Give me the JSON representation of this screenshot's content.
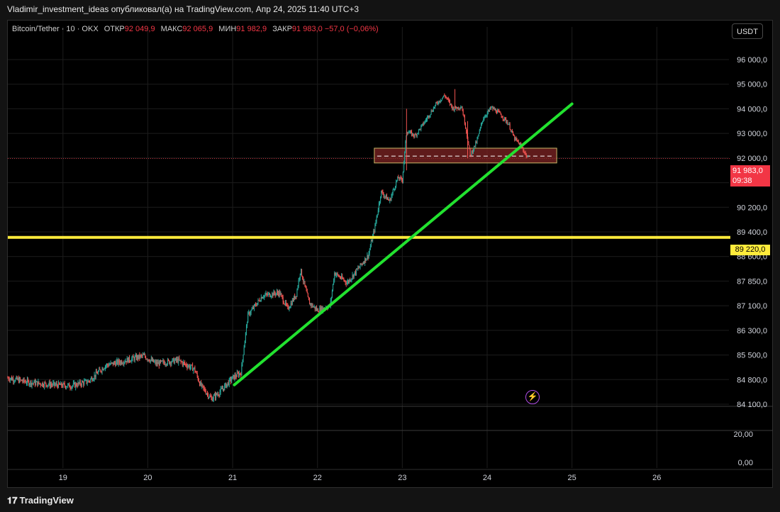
{
  "header": {
    "title": "Vladimir_investment_ideas опубликовал(а) на TradingView.com, Апр 24, 2025 11:40 UTC+3"
  },
  "legend": {
    "symbol": "Bitcoin/Tether · 10 · OKX",
    "open_label": "ОТКР",
    "open": "92 049,9",
    "high_label": "МАКС",
    "high": "92 065,9",
    "low_label": "МИН",
    "low": "91 982,9",
    "close_label": "ЗАКР",
    "close": "91 983,0",
    "change": "−57,0 (−0,06%)"
  },
  "currency_button": "USDT",
  "price_badge": {
    "price": "91 983,0",
    "countdown": "09:38"
  },
  "level_badge": "89 220,0",
  "indicator_icon": "lightning-icon",
  "footer": {
    "brand": "TradingView",
    "logo_icon": "tradingview-logo-icon"
  },
  "colors": {
    "up": "#26a69a",
    "down": "#ef5350",
    "trendline": "#22e22f",
    "level": "#ffeb3b",
    "zone": "#7f2424",
    "price_tag": "#f23645"
  },
  "chart_data": {
    "type": "candlestick",
    "title": "Bitcoin/Tether · 10 · OKX",
    "x_tick_labels": [
      "19",
      "20",
      "21",
      "22",
      "23",
      "24",
      "25",
      "26"
    ],
    "y_tick_labels": [
      "96 000,0",
      "95 000,0",
      "94 000,0",
      "93 000,0",
      "92 000,0",
      "91 000,0",
      "90 200,0",
      "89 400,0",
      "88 600,0",
      "87 850,0",
      "87 100,0",
      "86 300,0",
      "85 500,0",
      "84 800,0",
      "84 100,0"
    ],
    "y_ticks": [
      96000,
      95000,
      94000,
      93000,
      92000,
      91000,
      90200,
      89400,
      88600,
      87850,
      87100,
      86300,
      85500,
      84800,
      84100
    ],
    "ylim": [
      84000,
      97000
    ],
    "xlim": [
      18.35,
      26.85
    ],
    "price_path": [
      [
        18.35,
        84850
      ],
      [
        18.6,
        84720
      ],
      [
        18.9,
        84650
      ],
      [
        19.1,
        84620
      ],
      [
        19.3,
        84750
      ],
      [
        19.5,
        85200
      ],
      [
        19.75,
        85350
      ],
      [
        19.95,
        85480
      ],
      [
        20.1,
        85250
      ],
      [
        20.35,
        85350
      ],
      [
        20.55,
        85100
      ],
      [
        20.62,
        84650
      ],
      [
        20.75,
        84250
      ],
      [
        20.85,
        84450
      ],
      [
        21.0,
        84850
      ],
      [
        21.1,
        85000
      ],
      [
        21.18,
        86800
      ],
      [
        21.35,
        87400
      ],
      [
        21.55,
        87500
      ],
      [
        21.65,
        87000
      ],
      [
        21.75,
        87450
      ],
      [
        21.8,
        88200
      ],
      [
        21.9,
        87200
      ],
      [
        22.0,
        86950
      ],
      [
        22.15,
        87100
      ],
      [
        22.2,
        88100
      ],
      [
        22.35,
        87800
      ],
      [
        22.5,
        88300
      ],
      [
        22.6,
        88650
      ],
      [
        22.68,
        89600
      ],
      [
        22.75,
        90700
      ],
      [
        22.85,
        90400
      ],
      [
        22.95,
        91200
      ],
      [
        23.0,
        91100
      ],
      [
        23.05,
        93100
      ],
      [
        23.15,
        92900
      ],
      [
        23.25,
        93400
      ],
      [
        23.4,
        94200
      ],
      [
        23.5,
        94550
      ],
      [
        23.6,
        94000
      ],
      [
        23.7,
        94100
      ],
      [
        23.75,
        93200
      ],
      [
        23.8,
        92100
      ],
      [
        23.88,
        92700
      ],
      [
        23.95,
        93600
      ],
      [
        24.05,
        94050
      ],
      [
        24.15,
        93800
      ],
      [
        24.25,
        93400
      ],
      [
        24.32,
        92800
      ],
      [
        24.4,
        92500
      ],
      [
        24.48,
        91983
      ]
    ],
    "horizontal_level": 89220,
    "current_price": 91983,
    "trendline": {
      "from": [
        21.02,
        84650
      ],
      "to": [
        25.0,
        94200
      ]
    },
    "zone": {
      "x": [
        22.67,
        24.82
      ],
      "y": [
        91800,
        92400
      ]
    },
    "zone_midline": 92080,
    "volume_axis": {
      "tick_labels": [
        "20,00",
        "0,00"
      ],
      "ticks": [
        20,
        0
      ]
    }
  }
}
